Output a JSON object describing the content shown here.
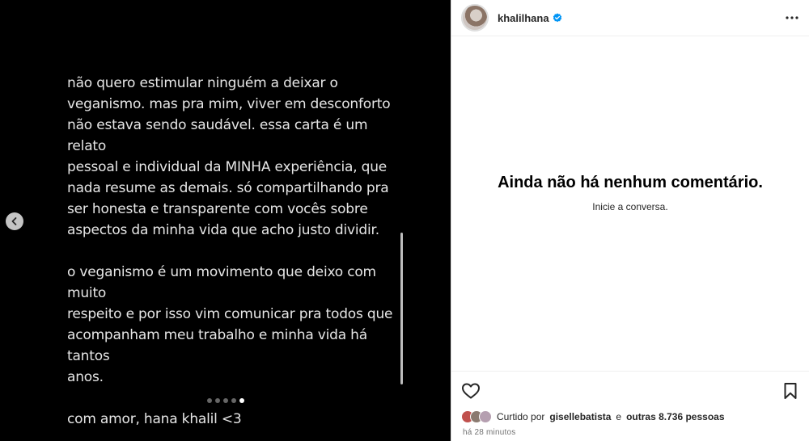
{
  "post": {
    "paragraphs": [
      "não quero estimular ninguém a deixar o\nveganismo. mas pra mim, viver em desconforto\nnão estava sendo saudável. essa carta é um relato\npessoal e individual da MINHA experiência, que\nnada resume as demais. só compartilhando pra\nser honesta e transparente com vocês sobre\naspectos da minha vida que acho justo dividir.",
      "o veganismo é um movimento que deixo com muito\nrespeito e por isso vim comunicar pra todos que\nacompanham meu trabalho e minha vida há tantos\nanos.",
      "com amor, hana khalil <3"
    ],
    "carousel": {
      "total": 5,
      "active_index": 4
    }
  },
  "header": {
    "username": "khalilhana",
    "verified": true
  },
  "comments": {
    "empty_title": "Ainda não há nenhum comentário.",
    "empty_subtitle": "Inicie a conversa."
  },
  "likes": {
    "prefix": "Curtido por",
    "user": "gisellebatista",
    "connector": "e",
    "others": "outras 8.736 pessoas",
    "avatar_colors": [
      "#c0504d",
      "#8a7a70",
      "#b59fb0"
    ]
  },
  "timestamp": "há 28 minutos",
  "colors": {
    "verified_blue": "#0095f6",
    "panel_bg": "#ffffff",
    "media_bg": "#000000"
  },
  "icons": {
    "prev": "chevron-left-icon",
    "more": "more-horizontal-icon",
    "like": "heart-icon",
    "save": "bookmark-icon",
    "verified": "verified-badge-icon"
  }
}
